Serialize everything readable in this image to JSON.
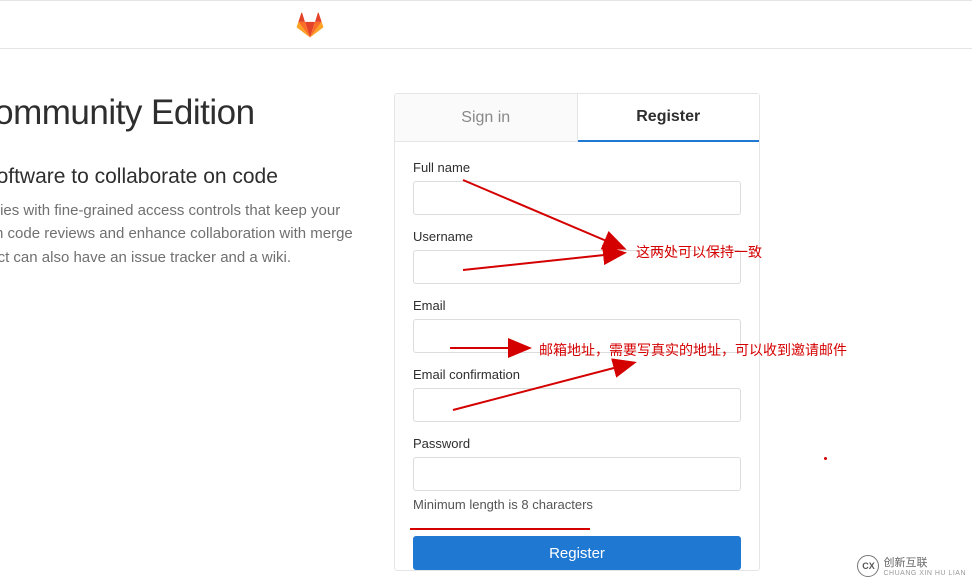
{
  "left": {
    "title": "GitLab Community Edition",
    "subtitle": "Open source software to collaborate on code",
    "desc": "Manage Git repositories with fine-grained access controls that keep your code secure. Perform code reviews and enhance collaboration with merge requests. Each project can also have an issue tracker and a wiki."
  },
  "tabs": {
    "signin": "Sign in",
    "register": "Register"
  },
  "fields": {
    "fullname_label": "Full name",
    "username_label": "Username",
    "email_label": "Email",
    "emailconf_label": "Email confirmation",
    "password_label": "Password",
    "password_help": "Minimum length is 8 characters"
  },
  "buttons": {
    "register": "Register"
  },
  "annotations": {
    "a1": "这两处可以保持一致",
    "a2": "邮箱地址，需要写真实的地址，可以收到邀请邮件"
  },
  "footer": {
    "brand": "创新互联",
    "sub": "CHUANG XIN HU LIAN"
  }
}
